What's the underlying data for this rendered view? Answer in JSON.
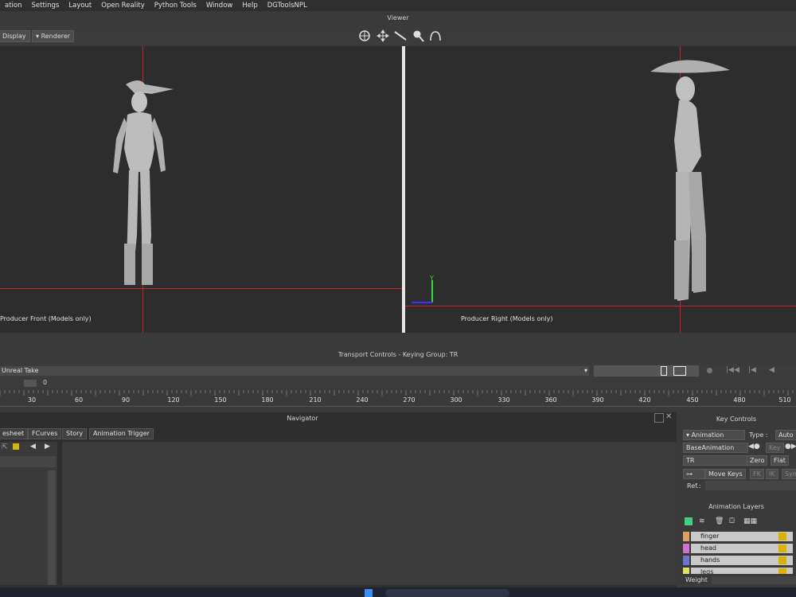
{
  "menu": [
    "ation",
    "Settings",
    "Layout",
    "Open Reality",
    "Python Tools",
    "Window",
    "Help",
    "DGToolsNPL"
  ],
  "viewer": {
    "title": "Viewer",
    "display_label": "Display",
    "renderer_label": "Renderer",
    "left_label": "Producer Front (Models only)",
    "right_label": "Producer Right (Models only)",
    "axis_y": "Y"
  },
  "transport": {
    "title": "Transport Controls  -  Keying Group: TR",
    "take": "Unreal Take",
    "frame": "0",
    "ruler_ticks": [
      "30",
      "60",
      "90",
      "120",
      "150",
      "180",
      "210",
      "240",
      "270",
      "300",
      "330",
      "360",
      "390",
      "420",
      "450",
      "480",
      "510"
    ]
  },
  "navigator": {
    "title": "Navigator",
    "tabs": [
      "esheet",
      "FCurves",
      "Story",
      "Animation Trigger"
    ]
  },
  "key_controls": {
    "title": "Key Controls",
    "animation_label": "Animation",
    "type_label": "Type :",
    "type_value": "Auto",
    "base_animation": "BaseAnimation",
    "key_label": "Key",
    "tr_value": "TR",
    "zero_label": "Zero",
    "flat_label": "Flat",
    "move_keys_label": "Move Keys",
    "fk_label": "FK",
    "ik_label": "IK",
    "sym_label": "Sym",
    "ref_label": "Ref.:",
    "layers_title": "Animation Layers",
    "weight_label": "Weight",
    "layers": [
      {
        "name": "finger",
        "color": "#e0a060"
      },
      {
        "name": "head",
        "color": "#d070d0"
      },
      {
        "name": "hands",
        "color": "#7070d0"
      },
      {
        "name": "legs",
        "color": "#e0e060"
      }
    ]
  }
}
